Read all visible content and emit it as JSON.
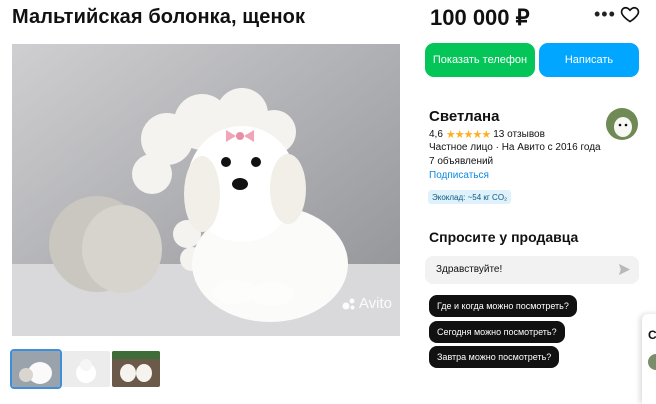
{
  "listing": {
    "title": "Мальтийская болонка, щенок",
    "price": "100 000 ₽",
    "photo_watermark": "Avito"
  },
  "actions": {
    "call_label": "Показать телефон",
    "message_label": "Написать"
  },
  "seller": {
    "name": "Светлана",
    "rating": "4,6",
    "stars": "★★★★★",
    "reviews": "13 отзывов",
    "type_since": "Частное лицо · На Авито с 2016 года",
    "ads_count": "7 объявлений",
    "subscribe_label": "Подписаться",
    "eco": "Экоклад: ~54 кг CO₂"
  },
  "ask": {
    "title": "Спросите у продавца",
    "input_value": "Здравствуйте!",
    "quick_questions": [
      "Где и когда можно посмотреть?",
      "Сегодня можно посмотреть?",
      "Завтра можно посмотреть?"
    ]
  },
  "side_panel_letter": "С",
  "colors": {
    "call": "#04c557",
    "message": "#00a6ff",
    "link": "#0a8ae0",
    "stars": "#ffb021"
  }
}
